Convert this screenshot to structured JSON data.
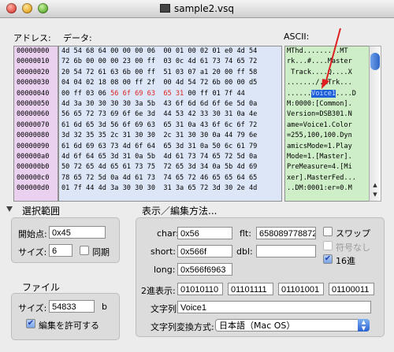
{
  "window": {
    "title": "sample2.vsq"
  },
  "headers": {
    "address": "アドレス:",
    "data": "データ:",
    "ascii": "ASCII:"
  },
  "addresses": [
    "00000000",
    "00000010",
    "00000020",
    "00000030",
    "00000040",
    "00000050",
    "00000060",
    "00000070",
    "00000080",
    "00000090",
    "000000a0",
    "000000b0",
    "000000c0",
    "000000d0"
  ],
  "hex_rows": [
    "4d 54 68 64 00 00 00 06  00 01 00 02 01 e0 4d 54",
    "72 6b 00 00 00 23 00 ff  03 0c 4d 61 73 74 65 72",
    "20 54 72 61 63 6b 00 ff  51 03 07 a1 20 00 ff 58",
    "04 04 02 18 08 00 ff 2f  00 4d 54 72 6b 00 00 d5",
    "00 ff 03 06 56 6f 69 63  65 31 00 ff 01 7f 44",
    "4d 3a 30 30 30 30 3a 5b  43 6f 6d 6d 6f 6e 5d 0a",
    "56 65 72 73 69 6f 6e 3d  44 53 42 33 30 31 0a 4e",
    "61 6d 65 3d 56 6f 69 63  65 31 0a 43 6f 6c 6f 72",
    "3d 32 35 35 2c 31 30 30  2c 31 30 30 0a 44 79 6e",
    "61 6d 69 63 73 4d 6f 64  65 3d 31 0a 50 6c 61 79",
    "4d 6f 64 65 3d 31 0a 5b  4d 61 73 74 65 72 5d 0a",
    "50 72 65 4d 65 61 73 75  72 65 3d 34 0a 5b 4d 69",
    "78 65 72 5d 0a 4d 61 73  74 65 72 46 65 65 64 65",
    "01 7f 44 4d 3a 30 30 30  31 3a 65 72 3d 30 2e 4d"
  ],
  "ascii_rows": [
    "MThd.........MT",
    "rk...#....Master",
    " Track....Q....X",
    "......./.MTrk...",
    "......Voice1....D",
    "M:0000:[Common].",
    "Version=DSB301.N",
    "ame=Voice1.Color",
    "=255,100,100.Dyn",
    "amicsMode=1.Play",
    "Mode=1.[Master].",
    "PreMeasure=4.[Mi",
    "xer].MasterFed...",
    "..DM:0001:er=0.M"
  ],
  "selection": {
    "ascii_row": 4,
    "ascii_pre": "......",
    "ascii_sel": "Voice1",
    "ascii_post": "....D",
    "hex_pre": "00 ff 03 06 ",
    "hex_sel": "56 6f 69 63  65 31",
    "hex_post": " 00 ff 01 7f 44"
  },
  "range": {
    "section_label": "選択範囲",
    "start_label": "開始点:",
    "start_value": "0x45",
    "size_label": "サイズ:",
    "size_value": "6",
    "sync_label": "同期",
    "sync_checked": false
  },
  "file": {
    "section_label": "ファイル",
    "size_label": "サイズ:",
    "size_value": "54833",
    "unit": "b",
    "edit_label": "編集を許可する",
    "edit_checked": true
  },
  "display": {
    "section_label": "表示／編集方法...",
    "char_label": "char:",
    "char_value": "0x56",
    "flt_label": "flt:",
    "flt_value": "658089778872",
    "short_label": "short:",
    "short_value": "0x566f",
    "dbl_label": "dbl:",
    "dbl_value": "",
    "long_label": "long:",
    "long_value": "0x566f6963",
    "swap_label": "スワップ",
    "swap_checked": false,
    "unsigned_label": "符号なし",
    "unsigned_checked": false,
    "hex_label": "16進",
    "hex_checked": true,
    "binary_label": "2進表示:",
    "binary_values": [
      "01010110",
      "01101111",
      "01101001",
      "01100011"
    ],
    "string_label": "文字列:",
    "string_value": "Voice1",
    "encoding_label": "文字列変換方式:",
    "encoding_value": "日本語（Mac OS）"
  },
  "colors": {
    "address_bg": "#ead1f0",
    "hex_bg": "#dde6f6",
    "ascii_bg": "#cdeec7",
    "highlight": "#dd2222",
    "selection": "#1e60d8"
  }
}
